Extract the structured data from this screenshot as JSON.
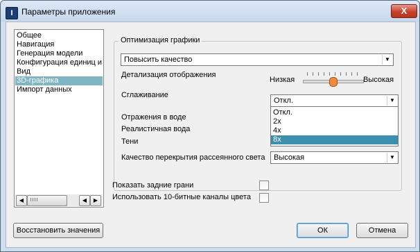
{
  "window": {
    "title": "Параметры приложения",
    "close_glyph": "X",
    "icon": "app-icon"
  },
  "nav": {
    "items": [
      {
        "label": "Общее"
      },
      {
        "label": "Навигация"
      },
      {
        "label": "Генерация модели"
      },
      {
        "label": "Конфигурация единиц и"
      },
      {
        "label": "Вид"
      },
      {
        "label": "3D-графика",
        "selected": true
      },
      {
        "label": "Импорт данных"
      }
    ]
  },
  "graphics": {
    "legend": "Оптимизация графики",
    "optimization_value": "Повысить качество",
    "detail_label": "Детализация отображения",
    "detail_low": "Низкая",
    "detail_high": "Высокая",
    "detail_level": 0.5,
    "aa_label": "Сглаживание",
    "aa_value": "Откл.",
    "aa_options": [
      "Откл.",
      "2x",
      "4x",
      "8x"
    ],
    "aa_highlighted": "8x",
    "water_reflections_label": "Отражения в воде",
    "realistic_water_label": "Реалистичная вода",
    "shadows_label": "Тени",
    "ao_label": "Качество перекрытия рассеянного света",
    "ao_value": "Высокая"
  },
  "options": {
    "back_faces_label": "Показать задние грани",
    "back_faces_checked": false,
    "tenbit_label": "Использовать 10-битные каналы цвета",
    "tenbit_checked": false
  },
  "buttons": {
    "restore": "Восстановить значения",
    "ok": "ОК",
    "cancel": "Отмена"
  },
  "colors": {
    "selection": "#7fb6c4",
    "dropdown_highlight": "#3d8fae",
    "slider_thumb": "#f08a3e",
    "close_button": "#c7412b"
  }
}
